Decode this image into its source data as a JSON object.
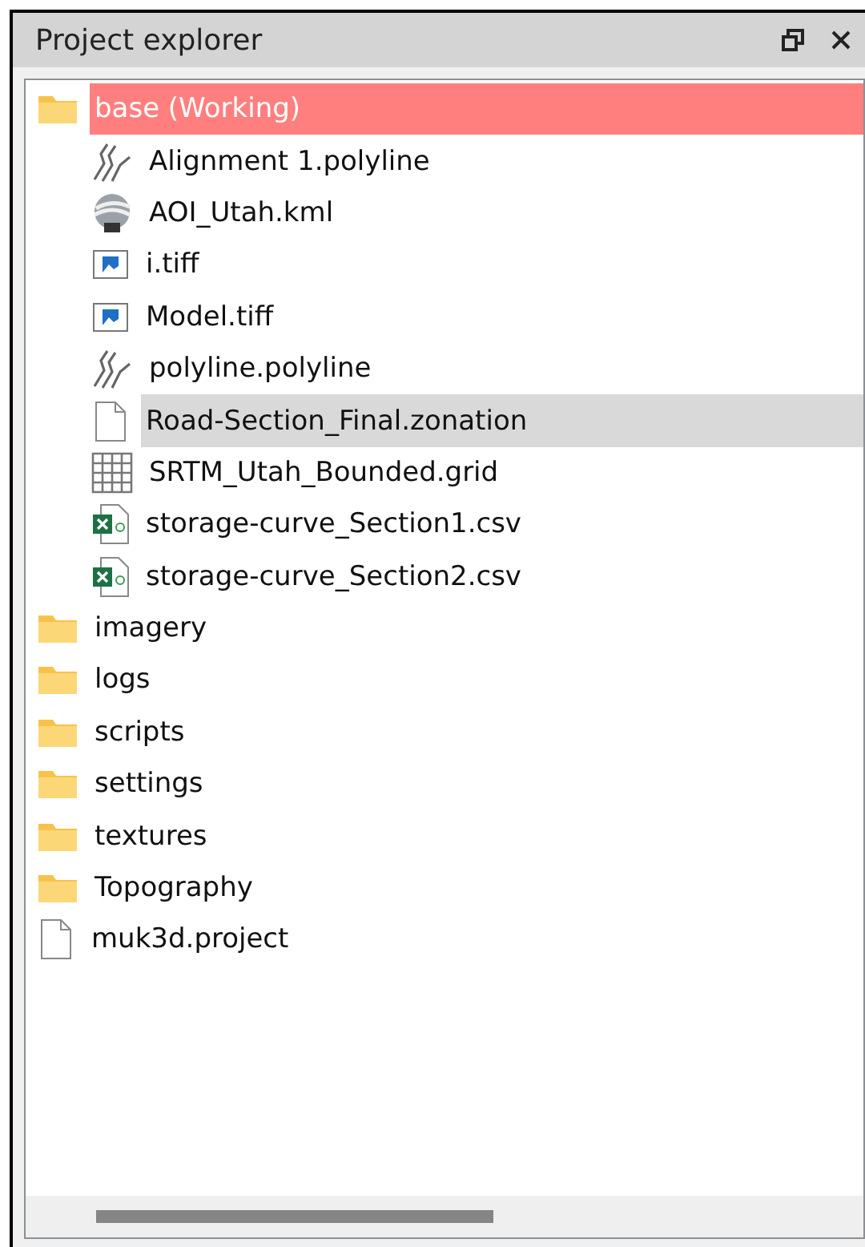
{
  "panel": {
    "title": "Project explorer"
  },
  "tree": [
    {
      "label": "base (Working)",
      "kind": "folder",
      "active": true,
      "selected": false,
      "children": [
        {
          "label": "Alignment 1.polyline",
          "kind": "polyline",
          "active": false,
          "selected": false
        },
        {
          "label": "AOI_Utah.kml",
          "kind": "kml",
          "active": false,
          "selected": false
        },
        {
          "label": "i.tiff",
          "kind": "image",
          "active": false,
          "selected": false
        },
        {
          "label": "Model.tiff",
          "kind": "image",
          "active": false,
          "selected": false
        },
        {
          "label": "polyline.polyline",
          "kind": "polyline",
          "active": false,
          "selected": false
        },
        {
          "label": "Road-Section_Final.zonation",
          "kind": "file",
          "active": false,
          "selected": true
        },
        {
          "label": "SRTM_Utah_Bounded.grid",
          "kind": "grid",
          "active": false,
          "selected": false
        },
        {
          "label": "storage-curve_Section1.csv",
          "kind": "csv",
          "active": false,
          "selected": false
        },
        {
          "label": "storage-curve_Section2.csv",
          "kind": "csv",
          "active": false,
          "selected": false
        }
      ]
    },
    {
      "label": "imagery",
      "kind": "folder",
      "active": false,
      "selected": false
    },
    {
      "label": "logs",
      "kind": "folder",
      "active": false,
      "selected": false
    },
    {
      "label": "scripts",
      "kind": "folder",
      "active": false,
      "selected": false
    },
    {
      "label": "settings",
      "kind": "folder",
      "active": false,
      "selected": false
    },
    {
      "label": "textures",
      "kind": "folder",
      "active": false,
      "selected": false
    },
    {
      "label": "Topography",
      "kind": "folder",
      "active": false,
      "selected": false
    },
    {
      "label": "muk3d.project",
      "kind": "file",
      "active": false,
      "selected": false
    }
  ]
}
